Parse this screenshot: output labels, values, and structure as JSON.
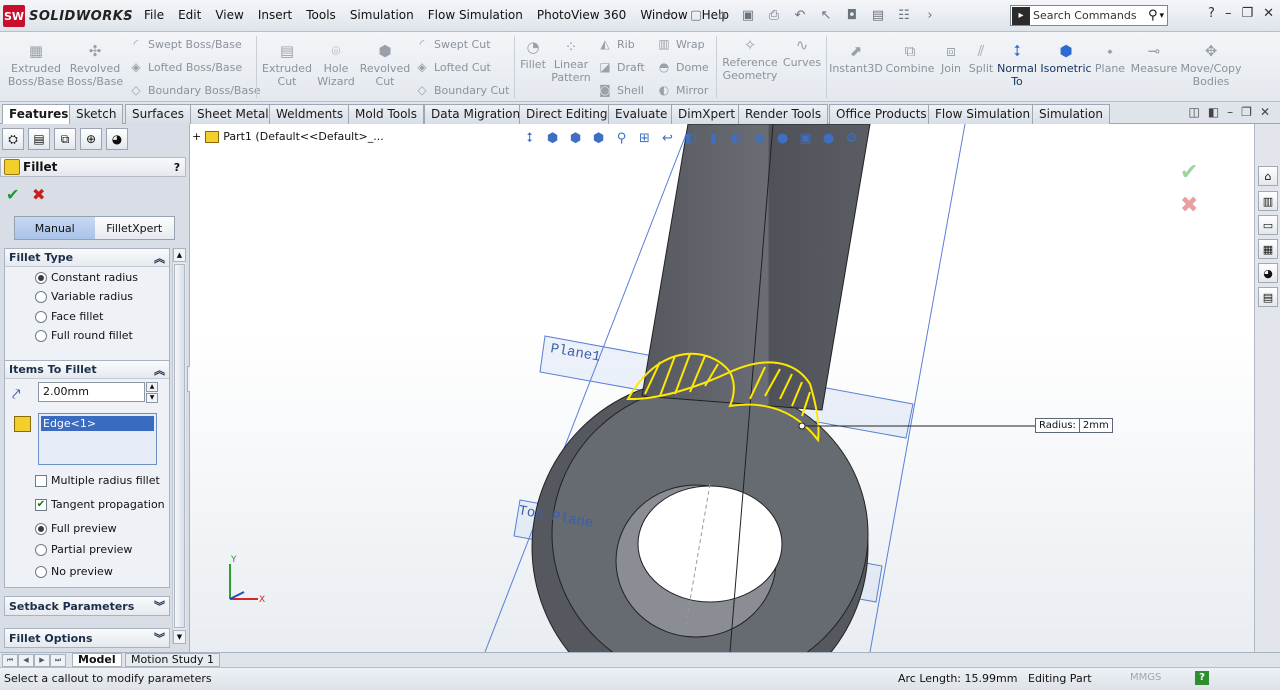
{
  "app": {
    "logo_text": "SOLIDWORKS",
    "logo_badge": "SW"
  },
  "menu": [
    "File",
    "Edit",
    "View",
    "Insert",
    "Tools",
    "Simulation",
    "Flow Simulation",
    "PhotoView 360",
    "Window",
    "Help"
  ],
  "search": {
    "placeholder": "Search Commands"
  },
  "ribbon": {
    "extruded_boss": "Extruded Boss/Base",
    "revolved_boss": "Revolved Boss/Base",
    "swept_boss": "Swept Boss/Base",
    "lofted_boss": "Lofted Boss/Base",
    "boundary_boss": "Boundary Boss/Base",
    "extruded_cut": "Extruded Cut",
    "hole_wizard": "Hole Wizard",
    "revolved_cut": "Revolved Cut",
    "swept_cut": "Swept Cut",
    "lofted_cut": "Lofted Cut",
    "boundary_cut": "Boundary Cut",
    "fillet": "Fillet",
    "linear_pattern": "Linear Pattern",
    "rib": "Rib",
    "draft": "Draft",
    "shell": "Shell",
    "wrap": "Wrap",
    "dome": "Dome",
    "mirror": "Mirror",
    "reference_geometry": "Reference Geometry",
    "curves": "Curves",
    "instant3d": "Instant3D",
    "combine": "Combine",
    "join": "Join",
    "split": "Split",
    "normal_to": "Normal To",
    "isometric": "Isometric",
    "plane": "Plane",
    "measure": "Measure",
    "move_copy": "Move/Copy Bodies"
  },
  "tabs": [
    "Features",
    "Sketch",
    "Surfaces",
    "Sheet Metal",
    "Weldments",
    "Mold Tools",
    "Data Migration",
    "Direct Editing",
    "Evaluate",
    "DimXpert",
    "Render Tools",
    "Office Products",
    "Flow Simulation",
    "Simulation"
  ],
  "active_tab": "Features",
  "property_manager": {
    "title": "Fillet",
    "help": "?",
    "mode_manual": "Manual",
    "mode_filletxpert": "FilletXpert",
    "fillet_type": {
      "header": "Fillet Type",
      "options": [
        "Constant radius",
        "Variable radius",
        "Face fillet",
        "Full round fillet"
      ],
      "selected": "Constant radius"
    },
    "items": {
      "header": "Items To Fillet",
      "radius": "2.00mm",
      "edge": "Edge<1>",
      "multiple_radius": "Multiple radius fillet",
      "multiple_radius_checked": false,
      "tangent": "Tangent propagation",
      "tangent_checked": true,
      "previews": [
        "Full preview",
        "Partial preview",
        "No preview"
      ],
      "selected_preview": "Full preview"
    },
    "setback": "Setback Parameters",
    "fillet_options": "Fillet Options"
  },
  "tree": {
    "item": "Part1  (Default<<Default>_..."
  },
  "viewport": {
    "plane1": "Plane1",
    "top_plane": "Top Plane",
    "callout_label": "Radius:",
    "callout_value": "2mm",
    "triad_y": "Y",
    "triad_x": "X"
  },
  "bottom_tabs": [
    "Model",
    "Motion Study 1"
  ],
  "status": {
    "message": "Select a callout to modify parameters",
    "arc_length": "Arc Length: 15.99mm",
    "mode": "Editing Part",
    "units": "MMGS",
    "help": "?"
  },
  "colors": {
    "accent": "#2d6bd1",
    "highlight": "#ffff00",
    "body": "#5c5f66"
  }
}
